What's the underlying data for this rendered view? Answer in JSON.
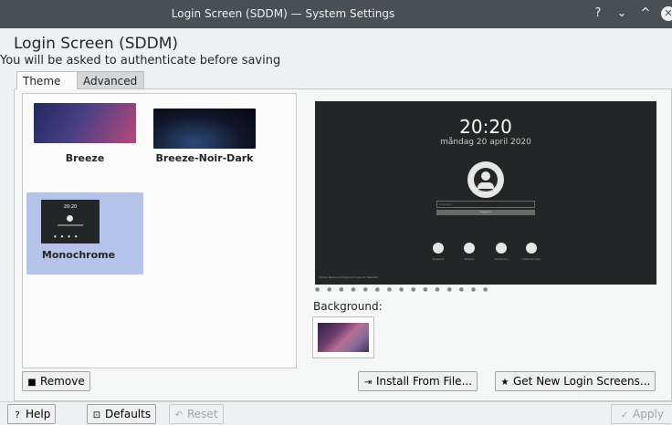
{
  "window": {
    "title": "Login Screen (SDDM) — System Settings",
    "help_btn": "?",
    "minimize_btn": "⌄",
    "maximize_btn": "^",
    "close_btn": "✕"
  },
  "header": {
    "title": "Login Screen (SDDM)",
    "subtitle": "You will be asked to authenticate before saving"
  },
  "tabs": [
    {
      "label": "Theme",
      "active": true
    },
    {
      "label": "Advanced",
      "active": false
    }
  ],
  "themes": [
    {
      "label": "Breeze",
      "selected": false
    },
    {
      "label": "Breeze-Noir-Dark",
      "selected": false
    },
    {
      "label": "Monochrome",
      "selected": true
    }
  ],
  "preview": {
    "time": "20:20",
    "date": "måndag 20 april 2020",
    "username": "Användare",
    "password_placeholder": "Lösenord",
    "login_label": "Logga in",
    "actions": [
      "Suspend",
      "Restart",
      "Shutdown",
      "Different User"
    ],
    "footer": "Virtual Keyboard   Keyboard Layout: Swedish",
    "dots": "● ● ● ● ● ● ● ● ● ● ● ● ● ● ●"
  },
  "background": {
    "label": "Background:"
  },
  "buttons": {
    "remove": "Remove",
    "install_from_file": "Install From File...",
    "get_new": "Get New Login Screens...",
    "help": "Help",
    "defaults": "Defaults",
    "reset": "Reset",
    "apply": "Apply"
  },
  "icons": {
    "remove": "trash-icon",
    "install": "import-icon",
    "get_new": "star-icon",
    "help": "question-icon",
    "defaults": "defaults-icon",
    "reset": "undo-icon",
    "apply": "check-icon"
  },
  "colors": {
    "titlebar": "#475057",
    "selection": "#b6c3ea",
    "preview_bg": "#232627",
    "window_bg": "#eff0f1"
  }
}
